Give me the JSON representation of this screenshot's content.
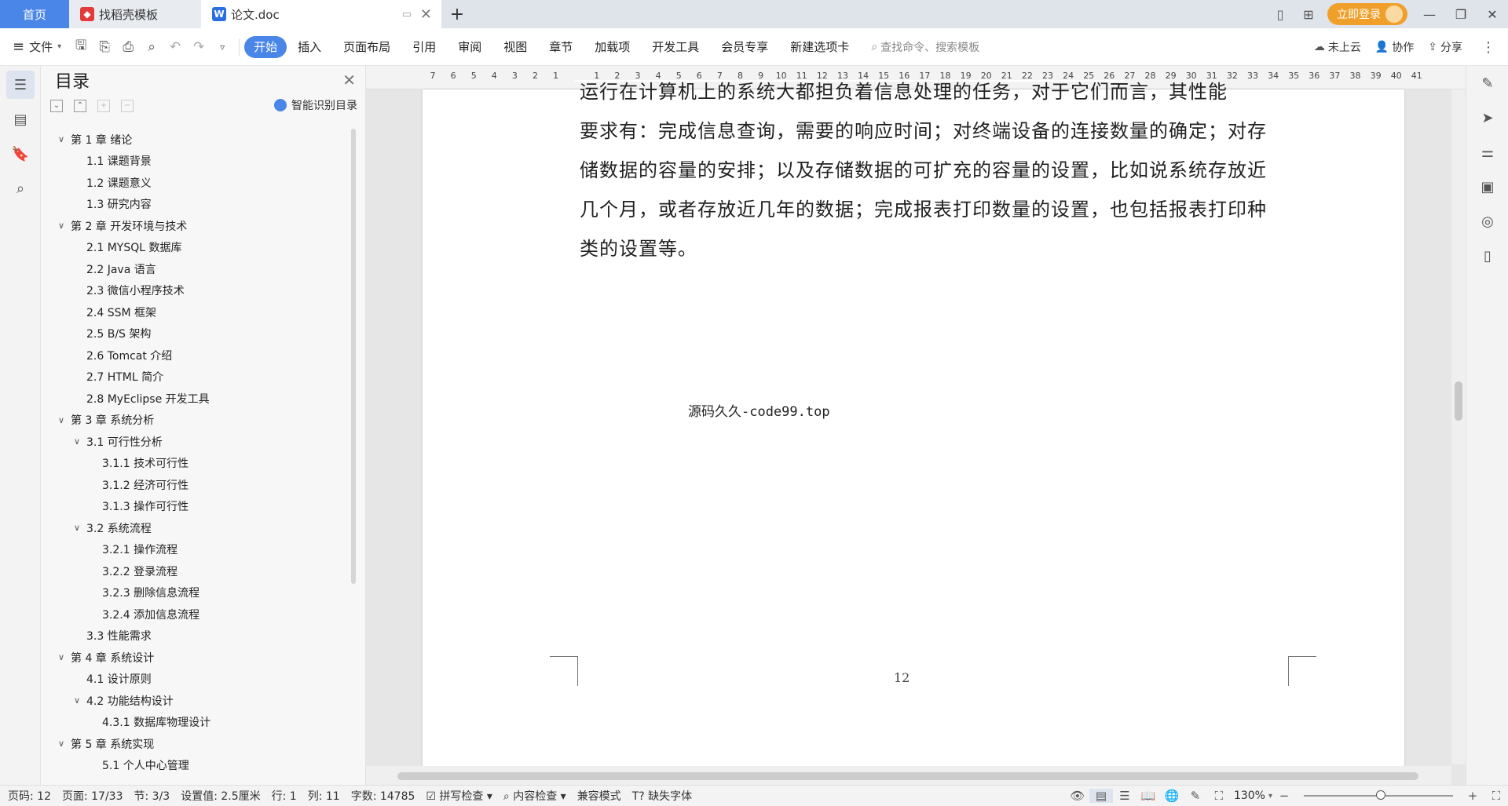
{
  "tabs": [
    {
      "label": "首页"
    },
    {
      "label": "找稻壳模板"
    },
    {
      "label": "论文.doc"
    }
  ],
  "login": {
    "label": "立即登录"
  },
  "ribbon": {
    "file_label": "文件",
    "tabs": [
      "开始",
      "插入",
      "页面布局",
      "引用",
      "审阅",
      "视图",
      "章节",
      "加载项",
      "开发工具",
      "会员专享",
      "新建选项卡"
    ],
    "search_placeholder": "查找命令、搜索模板",
    "cloud": "未上云",
    "collab": "协作",
    "share": "分享"
  },
  "toc": {
    "title": "目录",
    "smart_label": "智能识别目录",
    "items": [
      {
        "text": "第 1 章  绪论",
        "level": "l1",
        "chev": true
      },
      {
        "text": "1.1  课题背景",
        "level": "l2"
      },
      {
        "text": "1.2  课题意义",
        "level": "l2"
      },
      {
        "text": "1.3  研究内容",
        "level": "l2"
      },
      {
        "text": "第 2 章  开发环境与技术",
        "level": "l1",
        "chev": true
      },
      {
        "text": "2.1  MYSQL 数据库",
        "level": "l2"
      },
      {
        "text": "2.2  Java 语言",
        "level": "l2"
      },
      {
        "text": "2.3  微信小程序技术",
        "level": "l2"
      },
      {
        "text": "2.4  SSM 框架",
        "level": "l2"
      },
      {
        "text": "2.5  B/S 架构",
        "level": "l2"
      },
      {
        "text": "2.6  Tomcat 介绍",
        "level": "l2"
      },
      {
        "text": "2.7  HTML 简介",
        "level": "l2"
      },
      {
        "text": "2.8  MyEclipse 开发工具",
        "level": "l2"
      },
      {
        "text": "第 3 章  系统分析",
        "level": "l1",
        "chev": true
      },
      {
        "text": "3.1  可行性分析",
        "level": "l2c",
        "chev": true
      },
      {
        "text": "3.1.1  技术可行性",
        "level": "l3"
      },
      {
        "text": "3.1.2  经济可行性",
        "level": "l3"
      },
      {
        "text": "3.1.3  操作可行性",
        "level": "l3"
      },
      {
        "text": "3.2  系统流程",
        "level": "l2c",
        "chev": true
      },
      {
        "text": "3.2.1  操作流程",
        "level": "l3"
      },
      {
        "text": "3.2.2  登录流程",
        "level": "l3"
      },
      {
        "text": "3.2.3  删除信息流程",
        "level": "l3"
      },
      {
        "text": "3.2.4  添加信息流程",
        "level": "l3"
      },
      {
        "text": "3.3  性能需求",
        "level": "l2"
      },
      {
        "text": "第 4 章  系统设计",
        "level": "l1",
        "chev": true
      },
      {
        "text": "4.1  设计原则",
        "level": "l2"
      },
      {
        "text": "4.2  功能结构设计",
        "level": "l2c",
        "chev": true
      },
      {
        "text": "4.3.1  数据库物理设计",
        "level": "l3"
      },
      {
        "text": "第 5 章  系统实现",
        "level": "l1",
        "chev": true
      },
      {
        "text": "5.1 个人中心管理",
        "level": "l3"
      }
    ]
  },
  "ruler": {
    "left_numbers": [
      "7",
      "6",
      "5",
      "4",
      "3",
      "2",
      "1",
      "",
      "1",
      "2",
      "3",
      "4",
      "5",
      "6",
      "7",
      "8",
      "9",
      "10",
      "11",
      "12",
      "13",
      "14",
      "15",
      "16",
      "17",
      "18",
      "19",
      "20",
      "21",
      "22",
      "23",
      "24",
      "25",
      "26",
      "27",
      "28",
      "29",
      "30",
      "31",
      "32",
      "33",
      "34",
      "35",
      "36",
      "37",
      "38",
      "39",
      "40",
      "41"
    ]
  },
  "document": {
    "line0": "运行在计算机上的系统大都担负着信息处理的任务，对于它们而言，其性能",
    "line1": "要求有：完成信息查询，需要的响应时间；对终端设备的连接数量的确定；对存",
    "line2": "储数据的容量的安排；以及存储数据的可扩充的容量的设置，比如说系统存放近",
    "line3": "几个月，或者存放近几年的数据；完成报表打印数量的设置，也包括报表打印种",
    "line4": "类的设置等。",
    "watermark": "源码久久-code99.top",
    "page_number": "12"
  },
  "status": {
    "page_code": "页码: 12",
    "page": "页面: 17/33",
    "section": "节: 3/3",
    "setting": "设置值: 2.5厘米",
    "row": "行: 1",
    "col": "列: 11",
    "words": "字数: 14785",
    "spell": "拼写检查",
    "content_check": "内容检查",
    "compat": "兼容模式",
    "missing_font": "缺失字体",
    "zoom": "130%"
  },
  "colors": {
    "accent": "#4a86e8",
    "login": "#f0a02a"
  }
}
